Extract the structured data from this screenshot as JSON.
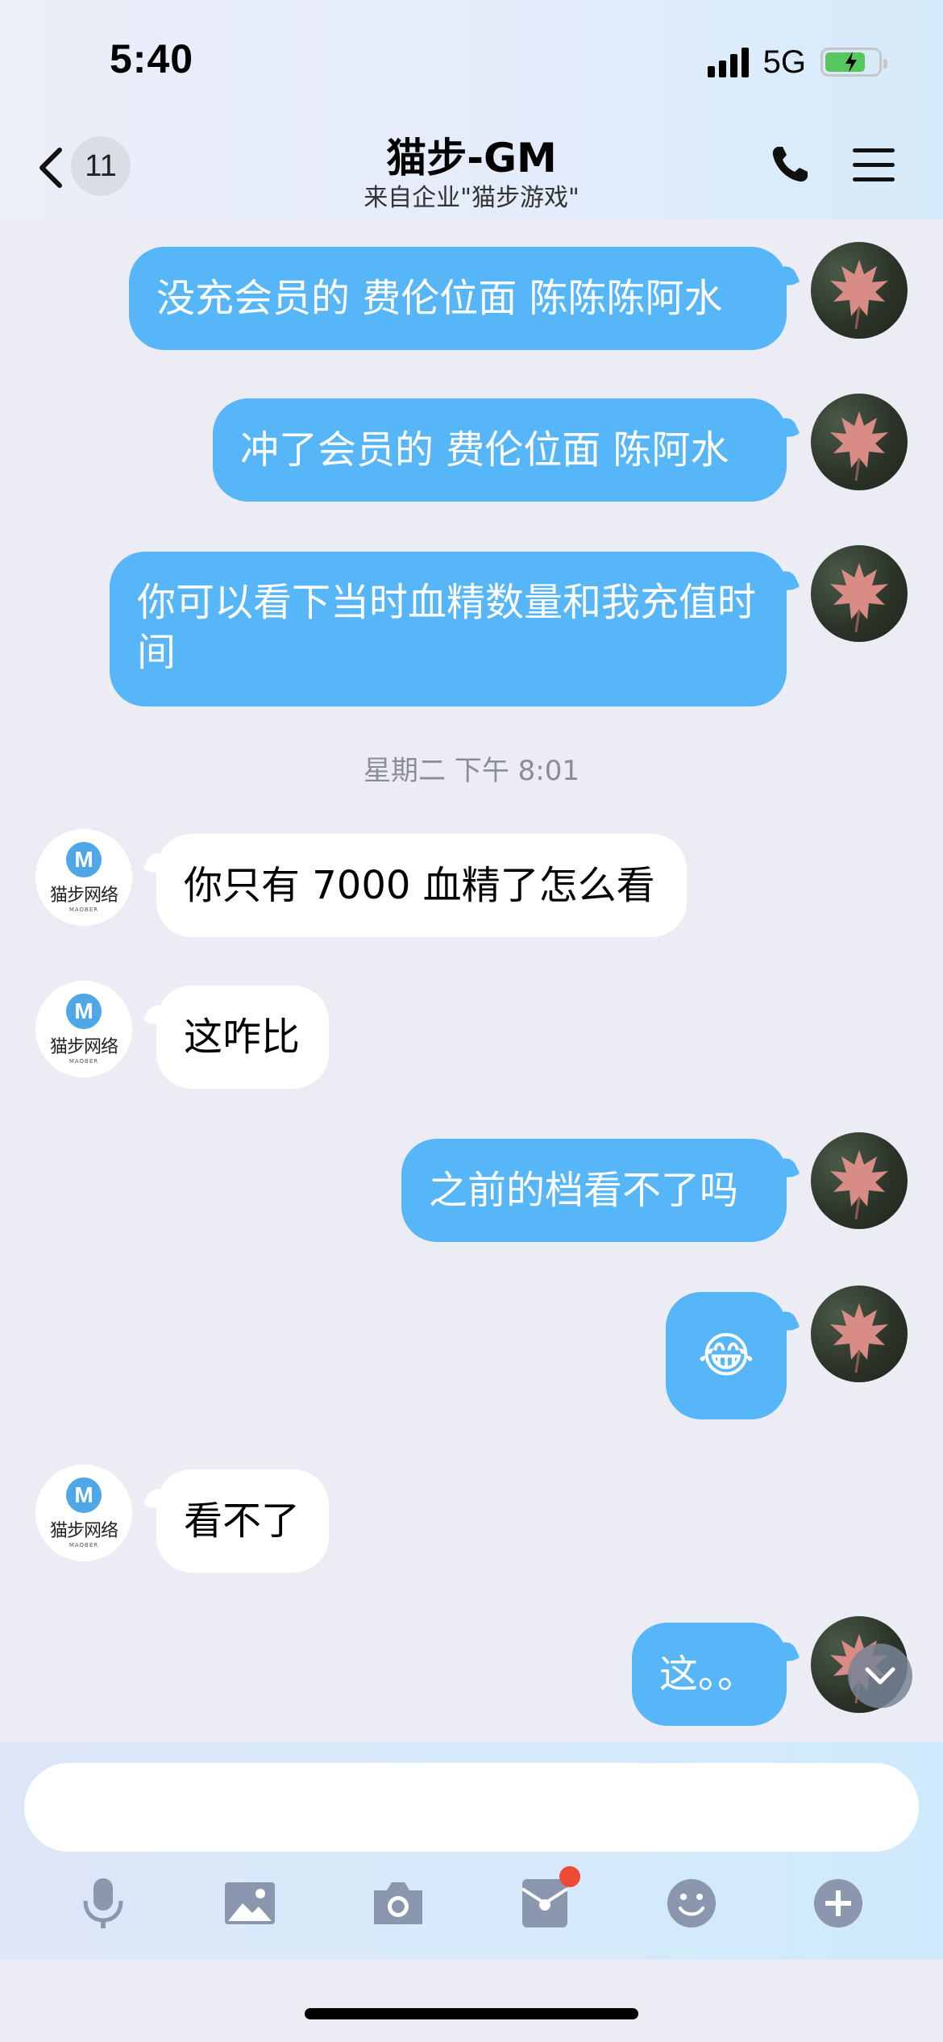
{
  "status_bar": {
    "time": "5:40",
    "network": "5G"
  },
  "nav": {
    "unread_count": "11",
    "title": "猫步-GM",
    "subtitle": "来自企业\"猫步游戏\""
  },
  "messages": [
    {
      "dir": "out",
      "text": "没充会员的 费伦位面 陈陈陈阿水"
    },
    {
      "dir": "out",
      "text": "冲了会员的 费伦位面 陈阿水"
    },
    {
      "dir": "out",
      "text": "你可以看下当时血精数量和我充值时间"
    },
    {
      "dir": "in",
      "text": "你只有 7000 血精了怎么看"
    },
    {
      "dir": "in",
      "text": "这咋比"
    },
    {
      "dir": "out",
      "text": "之前的档看不了吗"
    },
    {
      "dir": "out",
      "text": "😂"
    },
    {
      "dir": "in",
      "text": "看不了"
    },
    {
      "dir": "out",
      "text": "这。。"
    }
  ],
  "timestamp": "星期二 下午 8:01",
  "gm_avatar": {
    "logo_letter": "M",
    "brand_text": "猫步网络",
    "brand_sub": "MAOBER"
  },
  "colors": {
    "outgoing_bubble": "#56b6f7",
    "incoming_bubble": "#ffffff",
    "notification_dot": "#ee4b37"
  },
  "toolbar_icons": [
    "microphone-icon",
    "image-icon",
    "camera-icon",
    "red-packet-icon",
    "emoji-icon",
    "plus-icon"
  ]
}
